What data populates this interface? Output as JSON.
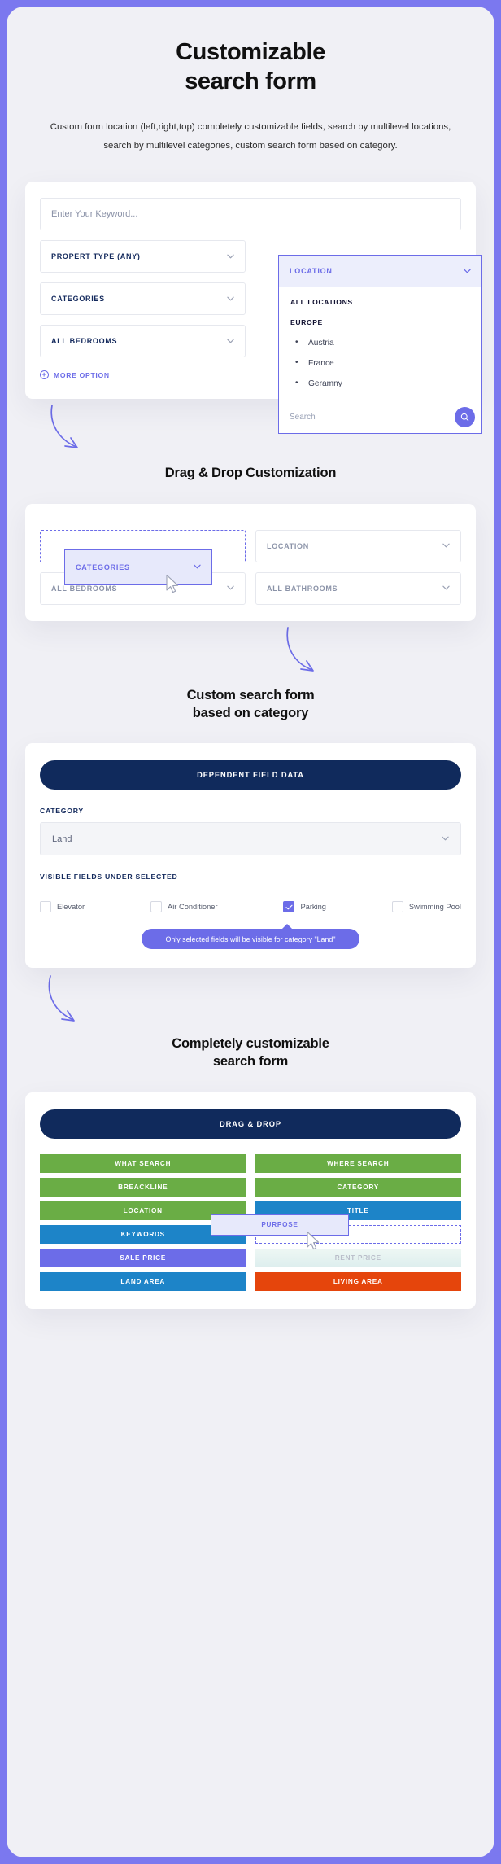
{
  "hero": {
    "title_line1": "Customizable",
    "title_line2": "search form",
    "description": "Custom form location (left,right,top) completely customizable fields, search by multilevel locations, search by multilevel categories, custom search form based on category."
  },
  "form1": {
    "keyword_placeholder": "Enter Your Keyword...",
    "left_fields": [
      {
        "label": "PROPERT TYPE (ANY)"
      },
      {
        "label": "CATEGORIES"
      },
      {
        "label": "ALL BEDROOMS"
      }
    ],
    "more_option_label": "MORE OPTION",
    "more_option_icon": "plus-circle-icon",
    "location": {
      "label": "LOCATION",
      "chevron_icon": "chevron-down-icon",
      "group_all": "ALL LOCATIONS",
      "group_europe": "EUROPE",
      "items": [
        "Austria",
        "France",
        "Geramny"
      ],
      "search_placeholder": "Search",
      "search_icon": "search-icon"
    }
  },
  "section2": {
    "title": "Drag & Drop Customization",
    "arrow_icon": "curved-arrow-icon",
    "fields": [
      {
        "label": "LOCATION"
      },
      {
        "label": "ALL BEDROOMS"
      },
      {
        "label": "ALL BATHROOMS"
      }
    ],
    "dragging_field": {
      "label": "CATEGORIES",
      "chevron_icon": "chevron-down-icon"
    },
    "cursor_icon": "mouse-pointer-icon"
  },
  "section3": {
    "title_line1": "Custom search form",
    "title_line2": "based on category",
    "arrow_icon": "curved-arrow-icon",
    "header_pill": "DEPENDENT FIELD DATA",
    "category_label": "CATEGORY",
    "category_value": "Land",
    "category_chevron_icon": "chevron-down-icon",
    "visible_fields_label": "VISIBLE FIELDS UNDER SELECTED",
    "checkboxes": [
      {
        "label": "Elevator",
        "checked": false
      },
      {
        "label": "Air Conditioner",
        "checked": false
      },
      {
        "label": "Parking",
        "checked": true
      },
      {
        "label": "Swimming Pool",
        "checked": false
      }
    ],
    "check_icon": "check-icon",
    "tooltip": "Only selected fields will be visible for category \"Land\""
  },
  "section4": {
    "title_line1": "Completely customizable",
    "title_line2": "search form",
    "arrow_icon": "curved-arrow-icon",
    "header_pill": "DRAG & DROP",
    "left_buttons": [
      {
        "label": "WHAT SEARCH",
        "color": "#6aad45"
      },
      {
        "label": "BREACKLINE",
        "color": "#6aad45"
      },
      {
        "label": "LOCATION",
        "color": "#6aad45"
      },
      {
        "label": "KEYWORDS",
        "color": "#1d84c8"
      },
      {
        "label": "SALE PRICE",
        "color": "#6c6ce8"
      },
      {
        "label": "LAND AREA",
        "color": "#1d84c8"
      }
    ],
    "right_buttons": [
      {
        "label": "WHERE SEARCH",
        "color": "#6aad45"
      },
      {
        "label": "CATEGORY",
        "color": "#6aad45"
      },
      {
        "label": "TITLE",
        "color": "#1d84c8"
      },
      {
        "label": "",
        "color": "drop-slot"
      },
      {
        "label": "RENT PRICE",
        "color": "faded"
      },
      {
        "label": "LIVING AREA",
        "color": "#e5450c"
      }
    ],
    "dragging_button": {
      "label": "PURPOSE"
    },
    "cursor_icon": "mouse-pointer-icon"
  },
  "colors": {
    "brand": "#6c6ce8",
    "navy": "#102a5c",
    "green": "#6aad45",
    "blue": "#1d84c8",
    "orange": "#e5450c",
    "page_bg": "#f0f0f5"
  }
}
